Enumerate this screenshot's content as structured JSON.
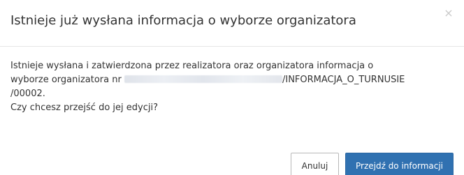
{
  "dialog": {
    "title": "Istnieje już wysłana informacja o wyborze organizatora",
    "close_glyph": "×"
  },
  "body": {
    "line1": "Istnieje wysłana i zatwierdzona przez realizatora oraz organizatora informacja o",
    "line2_prefix": "wyborze organizatora nr ",
    "line2_suffix": "/INFORMACJA_O_TURNUSIE",
    "line3": "/00002.",
    "question": "Czy chcesz przejść do jej edycji?"
  },
  "footer": {
    "cancel_label": "Anuluj",
    "confirm_label": "Przejdź do informacji"
  },
  "colors": {
    "primary": "#3071b1",
    "text": "#333333",
    "border": "#e5e5e5"
  },
  "icons": {
    "close": "close-icon"
  }
}
